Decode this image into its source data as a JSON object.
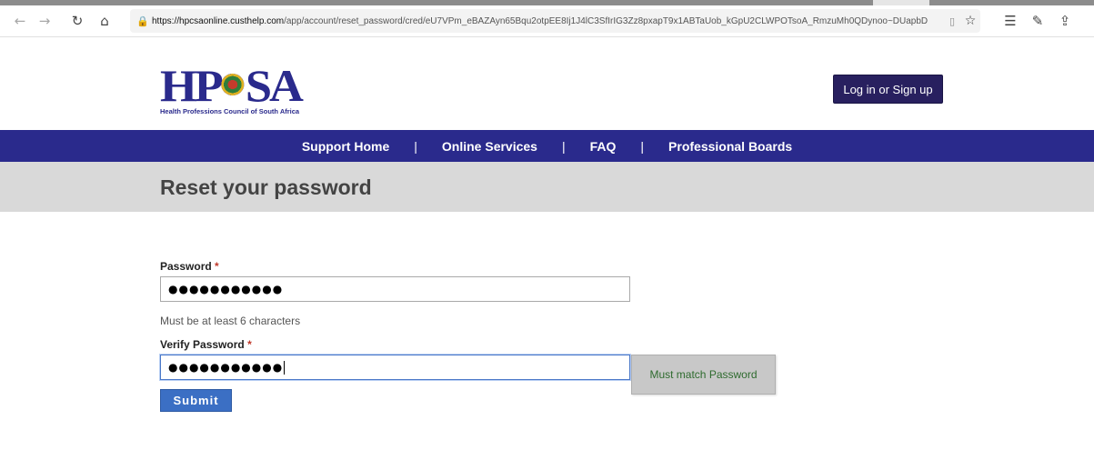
{
  "browser": {
    "url_host": "https://hpcsaonline.custhelp.com",
    "url_path": "/app/account/reset_password/cred/eU7VPm_eBAZAyn65Bqu2otpEE8Ij1J4lC3SfIrIG3Zz8pxapT9x1ABTaUob_kGpU2CLWPOTsoA_RmzuMh0QDynoo~DUapbD",
    "icons": {
      "back": "back-arrow-icon",
      "forward": "forward-arrow-icon",
      "refresh": "refresh-icon",
      "home": "home-icon",
      "lock": "lock-icon",
      "reader": "reader-view-icon",
      "favorite": "star-icon",
      "favorites_bar": "favorites-list-icon",
      "pen": "pen-icon",
      "share": "share-icon"
    }
  },
  "header": {
    "logo_text": "HPCSA",
    "logo_subtitle": "Health Professions Council of South Africa",
    "login_label": "Log in or Sign up",
    "brand_color": "#2a2a8c",
    "login_color": "#28205f"
  },
  "nav": {
    "separator": "|",
    "items": [
      {
        "label": "Support Home"
      },
      {
        "label": "Online Services"
      },
      {
        "label": "FAQ"
      },
      {
        "label": "Professional Boards"
      }
    ]
  },
  "page": {
    "title": "Reset your password"
  },
  "form": {
    "password": {
      "label": "Password",
      "required_mark": "*",
      "value": "●●●●●●●●●●●"
    },
    "password_hint": "Must be at least 6 characters",
    "verify": {
      "label": "Verify Password",
      "required_mark": "*",
      "value": "●●●●●●●●●●●"
    },
    "verify_tooltip": "Must match Password",
    "submit_label": "Submit",
    "submit_color": "#3b6fc4"
  }
}
